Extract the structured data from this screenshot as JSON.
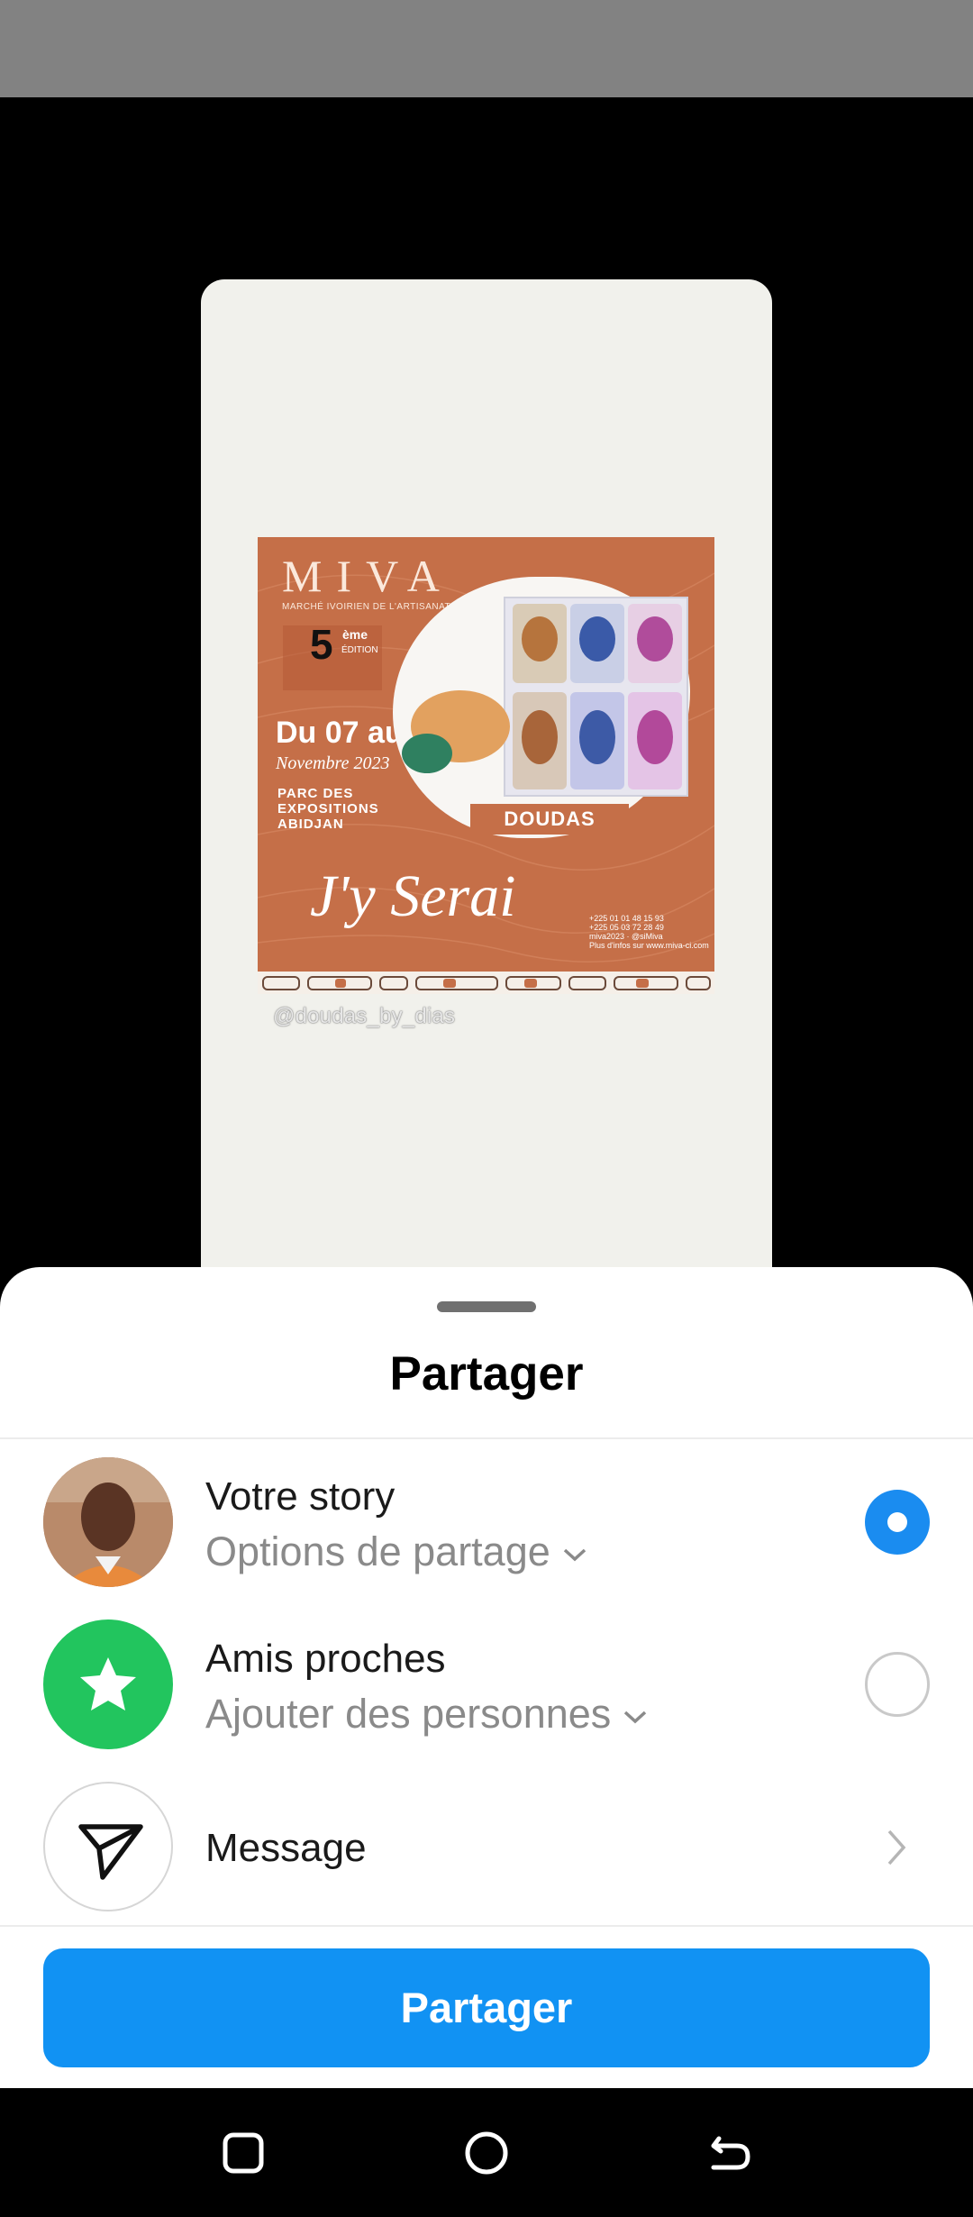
{
  "story_preview": {
    "poster": {
      "brand": "MIVA",
      "brand_subtitle": "MARCHÉ IVOIRIEN DE L'ARTISANAT",
      "edition_number": "5",
      "edition_superscript": "ème",
      "edition_word": "ÉDITION",
      "dates": "Du 07 au 11",
      "month": "Novembre 2023",
      "venue": [
        "PARC DES",
        "EXPOSITIONS",
        "ABIDJAN"
      ],
      "product_label": "DOUDAS",
      "slogan": "J'y Serai",
      "contacts": [
        "+225 01 01 48 15 93",
        "+225 05 03 72 28 49",
        "miva2023 · @siMiva",
        "Plus d'infos sur www.miva-ci.com"
      ]
    },
    "credit": "@doudas_by_dias"
  },
  "sheet": {
    "title": "Partager",
    "rows": [
      {
        "title": "Votre story",
        "subtitle": "Options de partage",
        "selected": true
      },
      {
        "title": "Amis proches",
        "subtitle": "Ajouter des personnes",
        "selected": false
      },
      {
        "title": "Message"
      }
    ],
    "button_label": "Partager"
  },
  "colors": {
    "accent": "#1192f3",
    "close_friends": "#22c55e",
    "poster": "#c56f48"
  },
  "icons": {
    "close_friends": "star-icon",
    "message": "paper-plane-icon",
    "nav": [
      "recent-apps-icon",
      "home-icon",
      "back-icon"
    ]
  }
}
